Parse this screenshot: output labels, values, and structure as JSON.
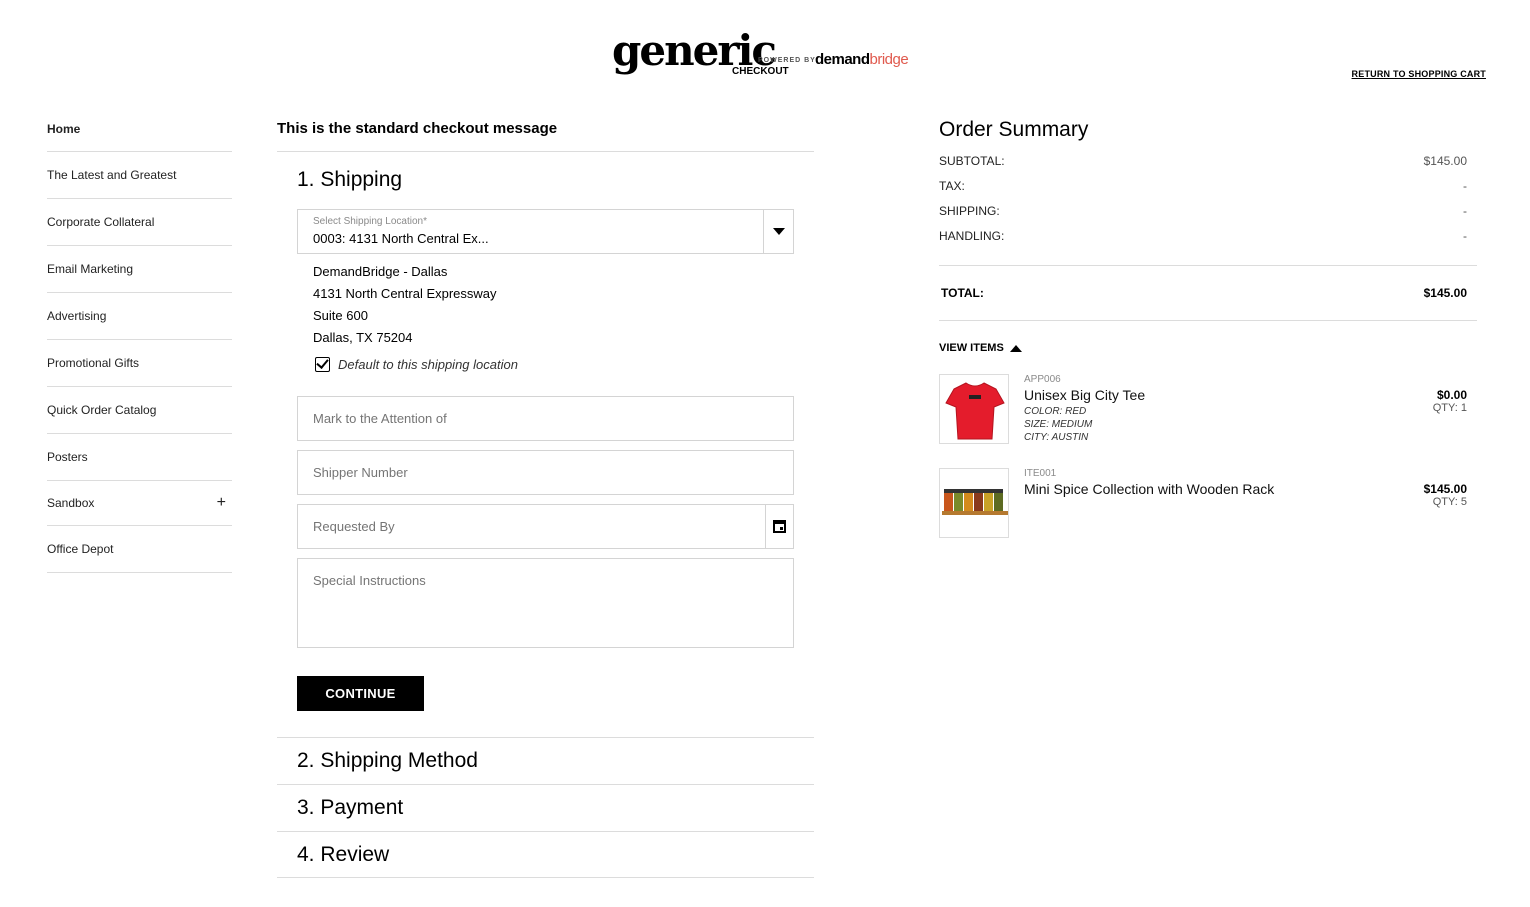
{
  "header": {
    "logo_main": "generic",
    "logo_powered": "POWERED BY",
    "logo_brand_a": "demand",
    "logo_brand_b": "bridge",
    "logo_sub": "CHECKOUT",
    "return_link": "RETURN TO SHOPPING CART"
  },
  "sidebar": {
    "items": [
      {
        "label": "Home"
      },
      {
        "label": "The Latest and Greatest"
      },
      {
        "label": "Corporate Collateral"
      },
      {
        "label": "Email Marketing"
      },
      {
        "label": "Advertising"
      },
      {
        "label": "Promotional Gifts"
      },
      {
        "label": "Quick Order Catalog"
      },
      {
        "label": "Posters"
      },
      {
        "label": "Sandbox",
        "expand": "+"
      },
      {
        "label": "Office Depot"
      }
    ]
  },
  "checkout": {
    "message": "This is the standard checkout message",
    "shipping": {
      "title": "1. Shipping",
      "location_label": "Select Shipping Location*",
      "location_value": "0003: 4131 North Central Ex...",
      "address": [
        "DemandBridge - Dallas",
        "4131 North Central Expressway",
        "Suite 600",
        "Dallas, TX 75204"
      ],
      "default_label": "Default to this shipping location",
      "attention_placeholder": "Mark to the Attention of",
      "shipper_placeholder": "Shipper Number",
      "requested_placeholder": "Requested By",
      "instructions_placeholder": "Special Instructions",
      "continue_label": "CONTINUE"
    },
    "steps": [
      "2. Shipping Method",
      "3. Payment",
      "4. Review"
    ]
  },
  "summary": {
    "title": "Order Summary",
    "rows": [
      {
        "label": "SUBTOTAL:",
        "value": "$145.00"
      },
      {
        "label": "TAX:",
        "value": "-"
      },
      {
        "label": "SHIPPING:",
        "value": "-"
      },
      {
        "label": "HANDLING:",
        "value": "-"
      }
    ],
    "total_label": "TOTAL:",
    "total_value": "$145.00",
    "view_items": "VIEW ITEMS",
    "items": [
      {
        "sku": "APP006",
        "name": "Unisex Big City Tee",
        "attrs": [
          "COLOR: RED",
          "SIZE: MEDIUM",
          "CITY: AUSTIN"
        ],
        "price": "$0.00",
        "qty": "QTY: 1"
      },
      {
        "sku": "ITE001",
        "name": "Mini Spice Collection with Wooden Rack",
        "attrs": [],
        "price": "$145.00",
        "qty": "QTY: 5"
      }
    ]
  },
  "colors": {
    "accent": "#000000",
    "brand_red": "#e05a4e",
    "divider": "#dcdcdc"
  }
}
